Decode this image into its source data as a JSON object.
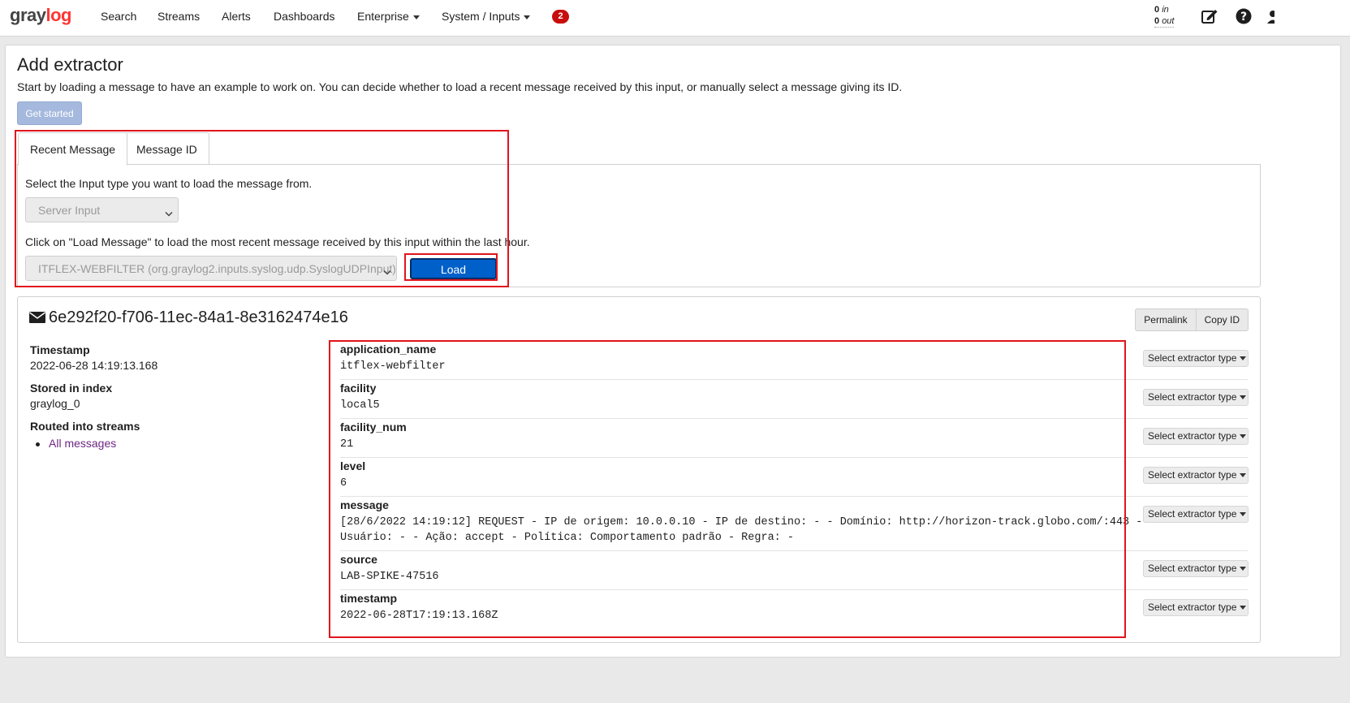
{
  "nav": {
    "logo_left": "gray",
    "logo_right": "log",
    "items": [
      "Search",
      "Streams",
      "Alerts",
      "Dashboards",
      "Enterprise",
      "System / Inputs"
    ],
    "notifications": "2",
    "throughput_in": "0",
    "throughput_in_label": "in",
    "throughput_out": "0",
    "throughput_out_label": "out",
    "icons": [
      "edit-icon",
      "help-icon",
      "user-icon"
    ]
  },
  "page": {
    "title": "Add extractor",
    "description": "Start by loading a message to have an example to work on. You can decide whether to load a recent message received by this input, or manually select a message giving its ID.",
    "get_started": "Get started"
  },
  "tabs": [
    {
      "label": "Recent Message",
      "active": true
    },
    {
      "label": "Message ID",
      "active": false
    }
  ],
  "recent": {
    "input_type_label": "Select the Input type you want to load the message from.",
    "input_type_value": "Server Input",
    "load_label": "Click on \"Load Message\" to load the most recent message received by this input within the last hour.",
    "input_value": "ITFLEX-WEBFILTER (org.graylog2.inputs.syslog.udp.SyslogUDPInput)",
    "load_button": "Load Message"
  },
  "message": {
    "id": "6e292f20-f706-11ec-84a1-8e3162474e16",
    "permalink": "Permalink",
    "copy_id": "Copy ID",
    "timestamp_label": "Timestamp",
    "timestamp_value": "2022-06-28 14:19:13.168",
    "index_label": "Stored in index",
    "index_value": "graylog_0",
    "streams_label": "Routed into streams",
    "stream": "All messages",
    "extractor_button": "Select extractor type",
    "fields": [
      {
        "name": "application_name",
        "value": "itflex-webfilter"
      },
      {
        "name": "facility",
        "value": "local5"
      },
      {
        "name": "facility_num",
        "value": "21"
      },
      {
        "name": "level",
        "value": "6"
      },
      {
        "name": "message",
        "value": "[28/6/2022 14:19:12] REQUEST - IP de origem: 10.0.0.10 - IP de destino: - - Domínio: http://horizon-track.globo.com/:443 -\nUsuário: - - Ação: accept - Política: Comportamento padrão - Regra: -"
      },
      {
        "name": "source",
        "value": "LAB-SPIKE-47516"
      },
      {
        "name": "timestamp",
        "value": "2022-06-28T17:19:13.168Z"
      }
    ]
  }
}
